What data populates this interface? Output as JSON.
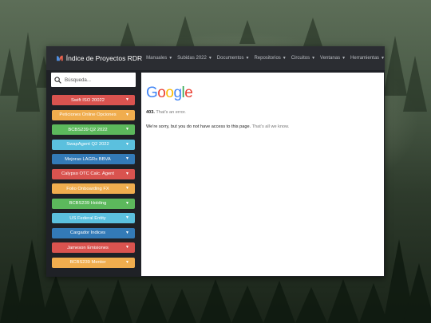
{
  "navbar": {
    "title": "Índice de Proyectos RDR",
    "items": [
      {
        "label": "Manuales"
      },
      {
        "label": "Subidas 2022"
      },
      {
        "label": "Documentos"
      },
      {
        "label": "Repositorios"
      },
      {
        "label": "Circuitos"
      },
      {
        "label": "Ventanas"
      },
      {
        "label": "Herramientas"
      }
    ]
  },
  "sidebar": {
    "search_placeholder": "Búsqueda...",
    "items": [
      {
        "label": "Swift ISO 20022",
        "color": "#d9534f"
      },
      {
        "label": "Peticiones Online Opciones",
        "color": "#f0ad4e"
      },
      {
        "label": "BCBS239 Q2 2022",
        "color": "#5cb85c"
      },
      {
        "label": "SwapAgent Q2 2022",
        "color": "#5bc0de"
      },
      {
        "label": "Mejoras LAGRs BBVA",
        "color": "#337ab7"
      },
      {
        "label": "Calypso OTC Calc. Agent",
        "color": "#d9534f"
      },
      {
        "label": "Folio Onboarding FX",
        "color": "#f0ad4e"
      },
      {
        "label": "BCBS239 Holding",
        "color": "#5cb85c"
      },
      {
        "label": "US Federal Entity",
        "color": "#5bc0de"
      },
      {
        "label": "Cargador Indices",
        "color": "#337ab7"
      },
      {
        "label": "Jameson Emisiones",
        "color": "#d9534f"
      },
      {
        "label": "BCBS239 Mentor",
        "color": "#f0ad4e"
      }
    ]
  },
  "content": {
    "logo_text": "Google",
    "error_code": "403.",
    "error_label": "That’s an error.",
    "message": "We're sorry, but you do not have access to this page.",
    "message_suffix": "That’s all we know."
  }
}
